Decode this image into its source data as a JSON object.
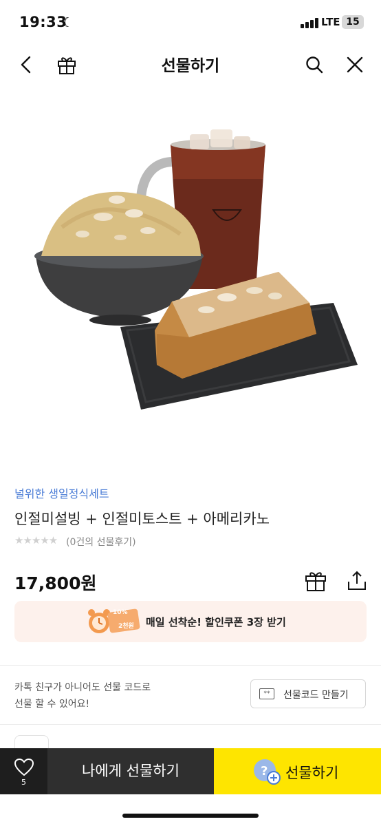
{
  "status_bar": {
    "time": "19:33",
    "network": "LTE",
    "battery": "15"
  },
  "nav": {
    "title": "선물하기",
    "icons": [
      "back-icon",
      "gift-icon",
      "search-icon",
      "close-icon"
    ]
  },
  "product": {
    "brand": "널위한 생일정식세트",
    "name": "인절미설빙 + 인절미토스트 + 아메리카노",
    "stars": "★★★★★",
    "review_text": "(0건의 선물후기)",
    "price": "17,800원"
  },
  "coupon": {
    "badge_percent": "10%",
    "badge_amount": "2천원",
    "text": "매일 선착순! 할인쿠폰 3장 받기"
  },
  "gift_code": {
    "description_line1": "카톡 친구가 아니어도 선물 코드로",
    "description_line2": "선물 할 수 있어요!",
    "icon_text": "**",
    "button_label": "선물코드 만들기"
  },
  "bottom_bar": {
    "like_count": "5",
    "self_gift_label": "나에게 선물하기",
    "gift_label": "선물하기"
  },
  "colors": {
    "brand_blue": "#4a7cd6",
    "kakao_yellow": "#fee500",
    "dark_button": "#2f2f2f",
    "coupon_bg": "#fdf1ec"
  }
}
